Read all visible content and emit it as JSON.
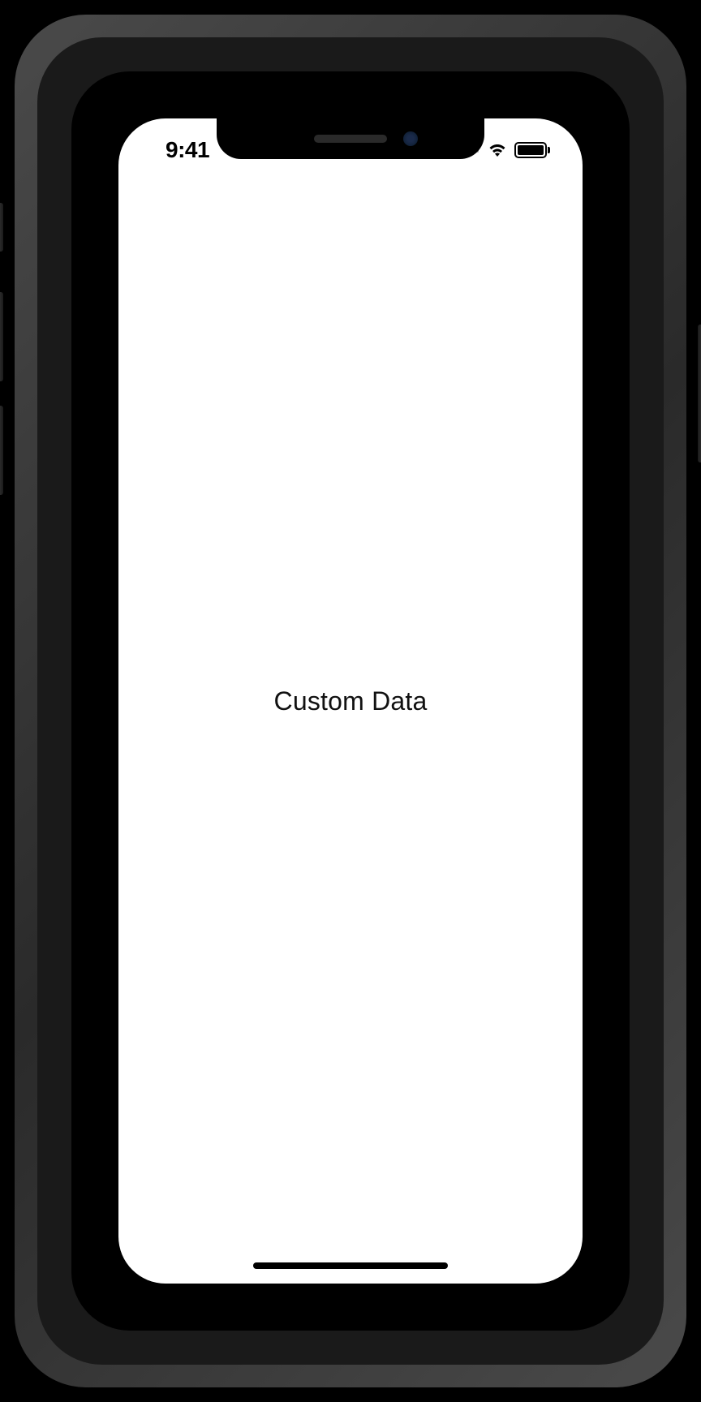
{
  "status_bar": {
    "time": "9:41"
  },
  "content": {
    "label": "Custom Data"
  }
}
